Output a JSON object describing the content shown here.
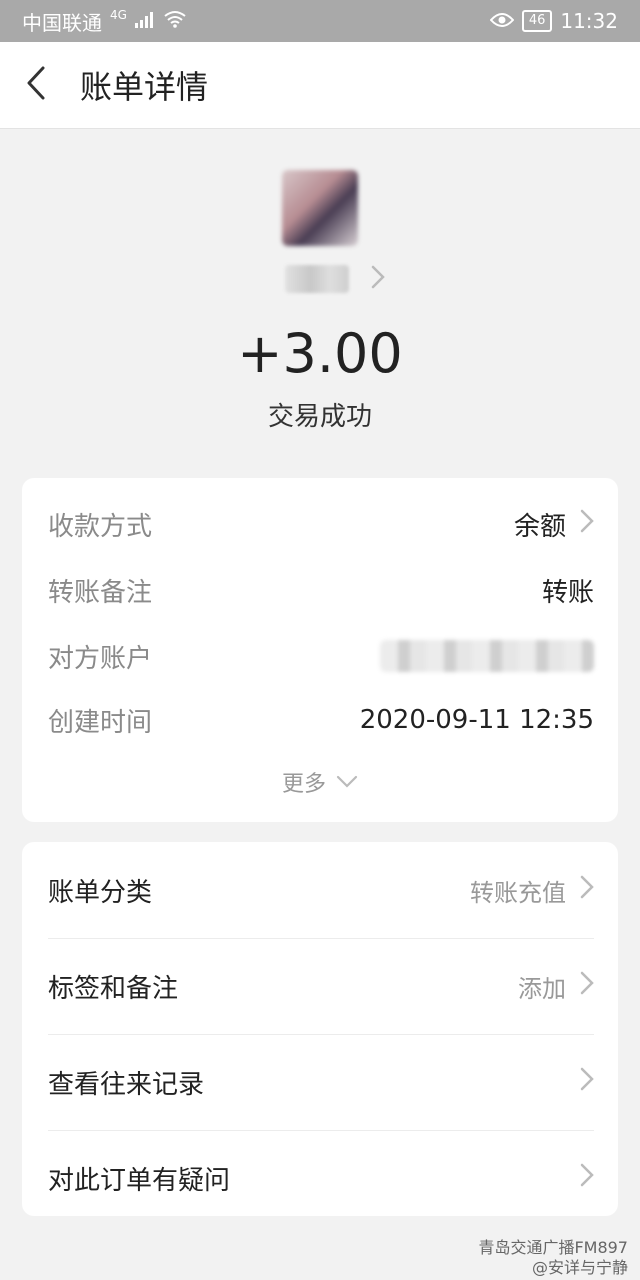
{
  "status_bar": {
    "carrier": "中国联通",
    "network": "4G",
    "battery": "46",
    "time": "11:32"
  },
  "nav": {
    "title": "账单详情"
  },
  "transaction": {
    "amount": "+3.00",
    "status": "交易成功"
  },
  "details": {
    "payment_method_label": "收款方式",
    "payment_method_value": "余额",
    "transfer_note_label": "转账备注",
    "transfer_note_value": "转账",
    "counterparty_label": "对方账户",
    "created_time_label": "创建时间",
    "created_time_value": "2020-09-11 12:35",
    "more_label": "更多"
  },
  "actions": [
    {
      "label": "账单分类",
      "value": "转账充值"
    },
    {
      "label": "标签和备注",
      "value": "添加"
    },
    {
      "label": "查看往来记录",
      "value": ""
    },
    {
      "label": "对此订单有疑问",
      "value": ""
    }
  ],
  "watermark": {
    "line1": "青岛交通广播FM897",
    "line2": "@安详与宁静"
  }
}
